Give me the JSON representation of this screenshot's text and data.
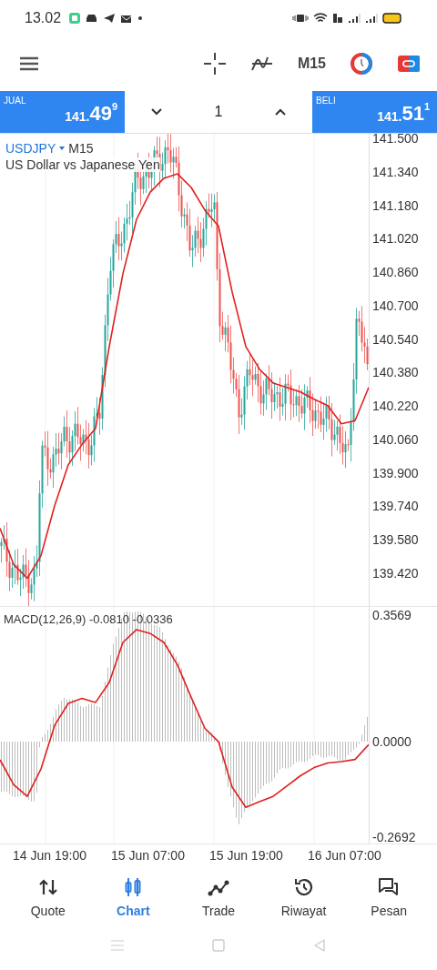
{
  "status_bar": {
    "time": "13.02"
  },
  "toolbar": {
    "timeframe": "M15"
  },
  "quote_bar": {
    "sell": {
      "label": "JUAL",
      "price_small": "141.",
      "price_big": "49",
      "price_sup": "9"
    },
    "volume": "1",
    "buy": {
      "label": "BELI",
      "price_small": "141.",
      "price_big": "51",
      "price_sup": "1"
    }
  },
  "chart": {
    "symbol": "USDJPY",
    "timeframe": "M15",
    "description": "US Dollar vs Japanese Yen",
    "chart_data": {
      "type": "line",
      "ylim": [
        139.263,
        141.522
      ],
      "grid": true,
      "yticks": [
        {
          "value": 141.5,
          "label": "141.500"
        },
        {
          "value": 141.34,
          "label": "141.340"
        },
        {
          "value": 141.18,
          "label": "141.180"
        },
        {
          "value": 141.02,
          "label": "141.020"
        },
        {
          "value": 140.86,
          "label": "140.860"
        },
        {
          "value": 140.7,
          "label": "140.700"
        },
        {
          "value": 140.54,
          "label": "140.540"
        },
        {
          "value": 140.38,
          "label": "140.380"
        },
        {
          "value": 140.22,
          "label": "140.220"
        },
        {
          "value": 140.06,
          "label": "140.060"
        },
        {
          "value": 139.9,
          "label": "139.900"
        },
        {
          "value": 139.74,
          "label": "139.740"
        },
        {
          "value": 139.58,
          "label": "139.580"
        },
        {
          "value": 139.42,
          "label": "139.420"
        }
      ],
      "series": [
        {
          "color": "#e0201e",
          "values": [
            139.635,
            139.461,
            139.396,
            139.504,
            139.743,
            139.939,
            140.035,
            140.113,
            140.504,
            140.852,
            141.113,
            141.243,
            141.309,
            141.33,
            141.265,
            141.157,
            141.08,
            140.765,
            140.504,
            140.396,
            140.33,
            140.309,
            140.287,
            140.252,
            140.222,
            140.135,
            140.15,
            140.309
          ]
        }
      ]
    },
    "indicator": {
      "label": "MACD(12,26,9) -0.0810 -0.0336",
      "chart_data": {
        "type": "line",
        "ylim": [
          -0.287,
          0.38
        ],
        "grid": true,
        "yticks": [
          {
            "value": 0.3569,
            "label": "0.3569"
          },
          {
            "value": 0,
            "label": "0.0000"
          },
          {
            "value": -0.2692,
            "label": "-0.2692"
          }
        ],
        "series": [
          {
            "color": "#e0201e",
            "values": [
              -0.051,
              -0.121,
              -0.154,
              -0.077,
              0.046,
              0.108,
              0.122,
              0.111,
              0.167,
              0.28,
              0.316,
              0.305,
              0.28,
              0.216,
              0.125,
              0.038,
              0,
              -0.128,
              -0.185,
              -0.169,
              -0.154,
              -0.125,
              -0.096,
              -0.073,
              -0.06,
              -0.056,
              -0.05,
              -0.008
            ]
          }
        ]
      }
    },
    "time_labels": [
      "14 Jun 19:00",
      "15 Jun 07:00",
      "15 Jun 19:00",
      "16 Jun 07:00"
    ]
  },
  "bottom_nav": [
    {
      "kind": "quote",
      "label": "Quote",
      "selected": false
    },
    {
      "kind": "chart",
      "label": "Chart",
      "selected": true
    },
    {
      "kind": "trade",
      "label": "Trade",
      "selected": false
    },
    {
      "kind": "history",
      "label": "Riwayat",
      "selected": false
    },
    {
      "kind": "messages",
      "label": "Pesan",
      "selected": false
    }
  ]
}
